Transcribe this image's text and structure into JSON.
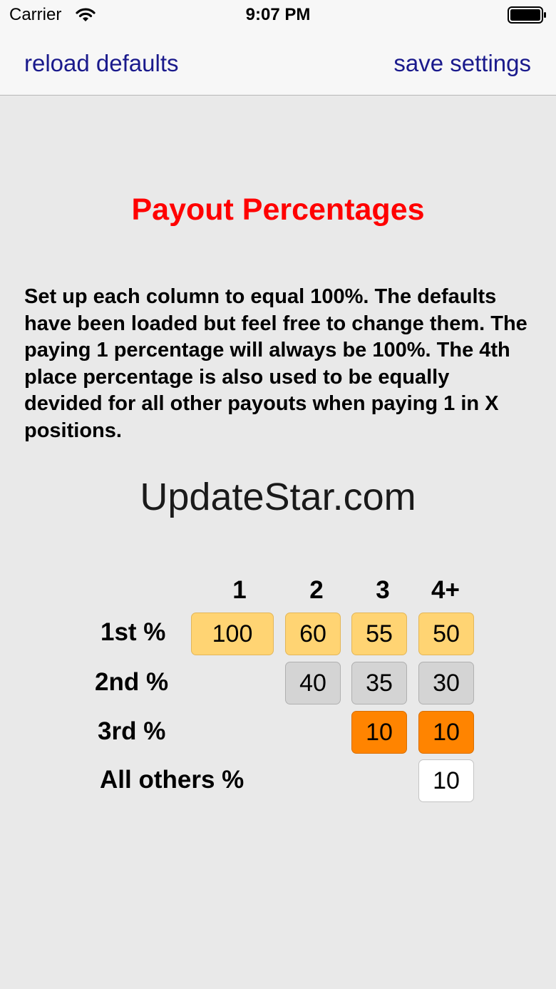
{
  "status_bar": {
    "carrier": "Carrier",
    "time": "9:07 PM"
  },
  "nav": {
    "left_button": "reload defaults",
    "right_button": "save settings"
  },
  "title": "Payout Percentages",
  "description": "Set up each column to equal 100%. The defaults have been loaded but feel free to change them. The paying 1 percentage will always be 100%. The 4th place percentage is also used to be equally devided for all other payouts when paying 1 in X positions.",
  "watermark": "UpdateStar.com",
  "table": {
    "columns": [
      "1",
      "2",
      "3",
      "4+"
    ],
    "rows": [
      {
        "label": "1st %",
        "values": [
          "100",
          "60",
          "55",
          "50"
        ]
      },
      {
        "label": "2nd %",
        "values": [
          "40",
          "35",
          "30"
        ]
      },
      {
        "label": "3rd %",
        "values": [
          "10",
          "10"
        ]
      },
      {
        "label": "All others %",
        "values": [
          "10"
        ]
      }
    ]
  },
  "colors": {
    "title": "#ff0000",
    "nav_text": "#1a1a8c",
    "first_row_cell": "#ffd473",
    "second_row_cell": "#d4d4d4",
    "third_row_cell": "#ff8400",
    "others_cell": "#ffffff"
  },
  "icons": {
    "wifi": "wifi-icon",
    "battery": "battery-icon"
  }
}
